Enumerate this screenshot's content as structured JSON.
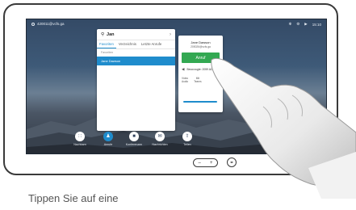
{
  "status_bar": {
    "address": "420011@vcfs.ga",
    "time": "15:10"
  },
  "search": {
    "query": "Jan",
    "tabs": [
      {
        "label": "Favoriten",
        "active": true
      },
      {
        "label": "Verzeichnis",
        "active": false
      },
      {
        "label": "Letzte Anrufe",
        "active": false
      }
    ],
    "section_label": "Favoriten",
    "results": [
      "Jane Dawson"
    ]
  },
  "contact": {
    "name": "Jane Dawson",
    "address": "205026@vcfs.ga",
    "call_label": "Anruf",
    "number": "Bevorzugte: 2059 ADDR",
    "options": [
      "Video",
      "Audio",
      "Mit",
      "Teams"
    ]
  },
  "toolbar": {
    "items": [
      {
        "label": "Nachbarn",
        "icon": "grid-icon"
      },
      {
        "label": "Anrufe",
        "icon": "person-icon"
      },
      {
        "label": "Konferenzen",
        "icon": "video-icon"
      },
      {
        "label": "Nachrichten",
        "icon": "message-icon"
      },
      {
        "label": "Teilen",
        "icon": "share-icon"
      }
    ]
  },
  "caption": "Tippen Sie auf eine",
  "colors": {
    "accent": "#1f8ccc",
    "call_green": "#33a852",
    "screen_bg": "#2d3f5a"
  }
}
